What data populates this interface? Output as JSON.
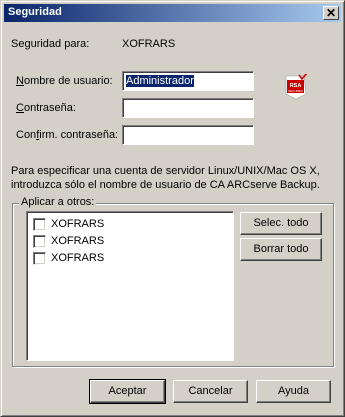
{
  "window": {
    "title": "Seguridad",
    "close_glyph": "✕"
  },
  "security_for": {
    "label": "Seguridad para:",
    "value": "XOFRARS"
  },
  "username": {
    "label": "Nombre de usuario:",
    "value": "Administrador"
  },
  "password": {
    "label": "Contraseña:",
    "value": ""
  },
  "confirm_password": {
    "label": "Confirm. contraseña:",
    "value": ""
  },
  "rsa_badge": {
    "top": "RSA",
    "bottom": "SECURED"
  },
  "info_text_line1": "Para especificar una cuenta de servidor Linux/UNIX/Mac OS X,",
  "info_text_line2": "introduzca sólo el nombre de usuario de CA ARCserve Backup.",
  "apply_group": {
    "label": "Aplicar a otros:",
    "items": [
      {
        "label": "XOFRARS",
        "checked": false
      },
      {
        "label": "XOFRARS",
        "checked": false
      },
      {
        "label": "XOFRARS",
        "checked": false
      }
    ],
    "select_all": "Selec. todo",
    "clear_all": "Borrar todo"
  },
  "buttons": {
    "ok": "Aceptar",
    "cancel": "Cancelar",
    "help": "Ayuda"
  },
  "colors": {
    "title_start": "#0a246a",
    "title_end": "#a6caf0",
    "face": "#d4d0c8",
    "rsa_red": "#cc0000"
  }
}
